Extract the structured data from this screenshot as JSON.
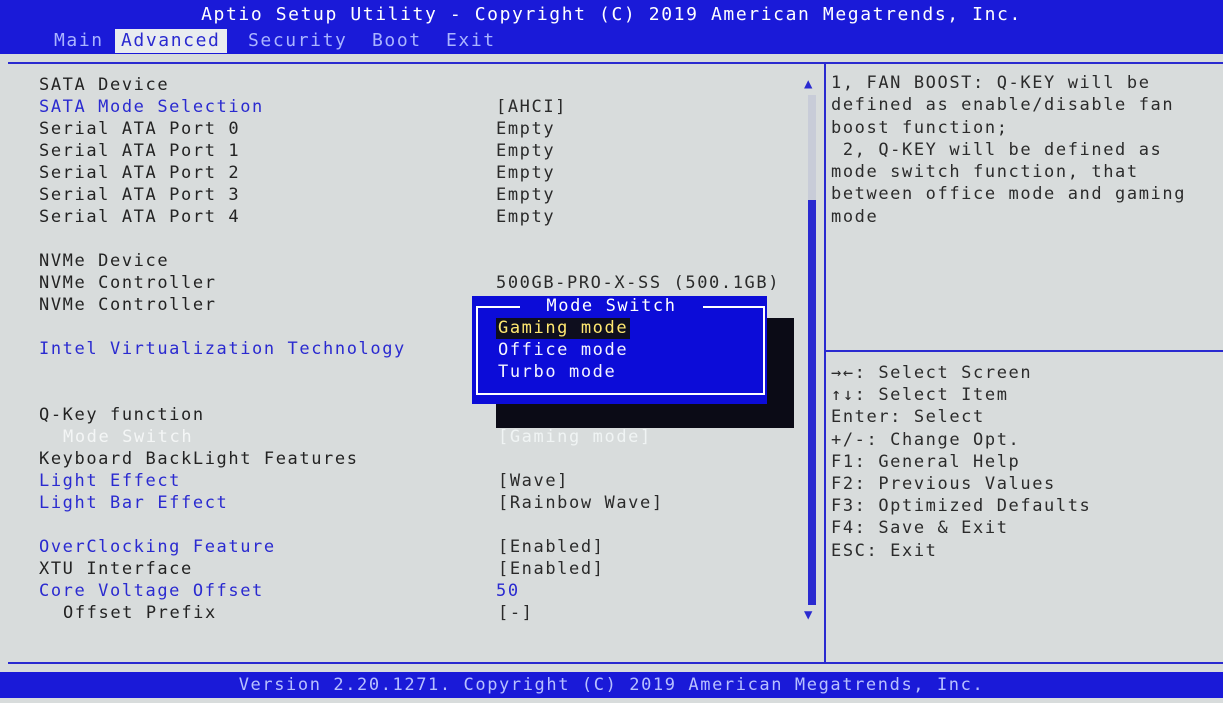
{
  "header": {
    "title": "Aptio Setup Utility - Copyright (C) 2019 American Megatrends, Inc.",
    "tabs": [
      {
        "label": "Main"
      },
      {
        "label": "Advanced",
        "active": true
      },
      {
        "label": "Security"
      },
      {
        "label": "Boot"
      },
      {
        "label": "Exit"
      }
    ]
  },
  "settings": {
    "rows": [
      {
        "label": "SATA Device",
        "value": ""
      },
      {
        "label": "SATA Mode Selection",
        "value": "[AHCI]"
      },
      {
        "label": "Serial ATA Port 0",
        "value": "Empty"
      },
      {
        "label": "Serial ATA Port 1",
        "value": "Empty"
      },
      {
        "label": "Serial ATA Port 2",
        "value": "Empty"
      },
      {
        "label": "Serial ATA Port 3",
        "value": "Empty"
      },
      {
        "label": "Serial ATA Port 4",
        "value": "Empty"
      },
      {
        "label": "NVMe Device",
        "value": ""
      },
      {
        "label": "NVMe Controller",
        "value": "500GB-PRO-X-SS (500.1GB)"
      },
      {
        "label": "NVMe Controller",
        "value": ""
      },
      {
        "label": "Intel Virtualization Technology",
        "value": ""
      },
      {
        "label": "Q-Key function",
        "value": ""
      },
      {
        "label": "Mode Switch",
        "value": "[Gaming mode]"
      },
      {
        "label": "Keyboard BackLight Features",
        "value": ""
      },
      {
        "label": "Light Effect",
        "value": "[Wave]"
      },
      {
        "label": "Light Bar Effect",
        "value": "[Rainbow Wave]"
      },
      {
        "label": "OverClocking Feature",
        "value": "[Enabled]"
      },
      {
        "label": "XTU Interface",
        "value": "[Enabled]"
      },
      {
        "label": "Core Voltage Offset",
        "value": "50"
      },
      {
        "label": "Offset Prefix",
        "value": "[-]"
      }
    ]
  },
  "help": {
    "lines": [
      "1, FAN BOOST: Q-KEY will be",
      "defined as enable/disable fan",
      "boost function;",
      " 2, Q-KEY will be defined as",
      "mode switch function, that",
      "between office mode and gaming",
      "mode"
    ]
  },
  "keys": {
    "lines": [
      "→←: Select Screen",
      "↑↓: Select Item",
      "Enter: Select",
      "+/-: Change Opt.",
      "F1: General Help",
      "F2: Previous Values",
      "F3: Optimized Defaults",
      "F4: Save & Exit",
      "ESC: Exit"
    ]
  },
  "popup": {
    "title": "Mode Switch",
    "options": [
      "Gaming mode",
      "Office mode",
      "Turbo mode"
    ],
    "selected": "Gaming mode"
  },
  "footer": {
    "text": "Version 2.20.1271. Copyright (C) 2019 American Megatrends, Inc."
  },
  "icons": {
    "scroll_up": "▲",
    "scroll_down": "▼"
  },
  "colors": {
    "bios_blue": "#1a1ad8",
    "highlight_text": "#2a2ad0",
    "selected_option": "#ffe870"
  }
}
